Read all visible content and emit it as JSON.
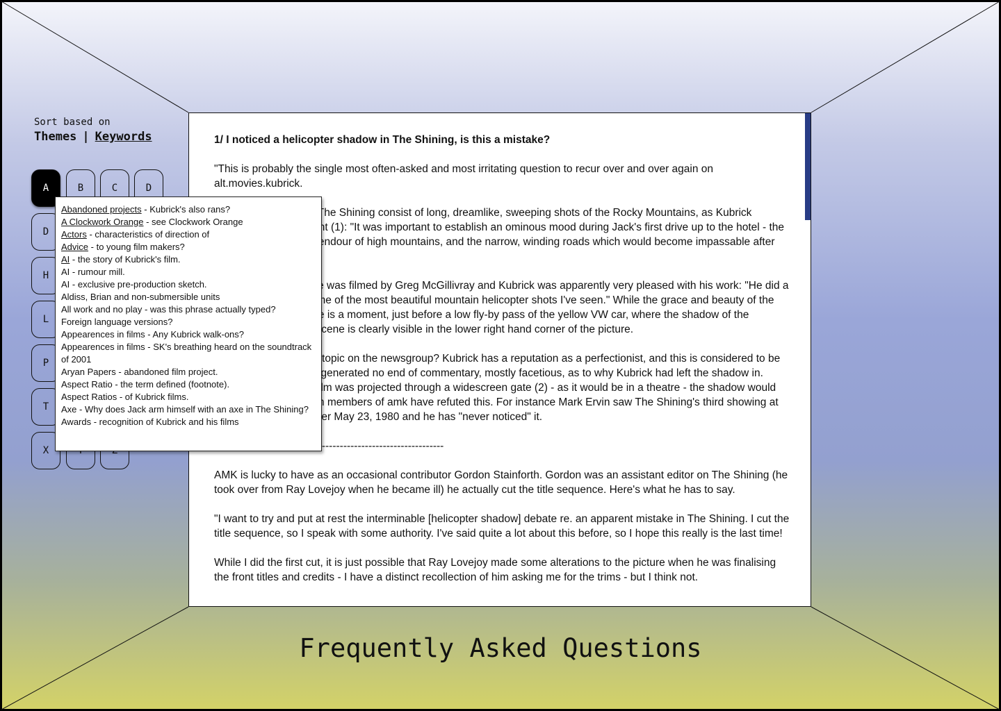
{
  "sort": {
    "label": "Sort based on",
    "themes": "Themes",
    "separator": "|",
    "keywords": "Keywords"
  },
  "letters": [
    "A",
    "B",
    "C",
    "D",
    "D",
    "H",
    "L",
    "P",
    "T",
    "X",
    "Y",
    "Z"
  ],
  "active_letter": "A",
  "popup_items": [
    {
      "link": "Abandoned projects",
      "text": " - Kubrick's also rans?"
    },
    {
      "link": "A Clockwork Orange",
      "text": " - see Clockwork Orange"
    },
    {
      "link": "Actors",
      "text": " - characteristics of direction of"
    },
    {
      "link": "Advice",
      "text": " - to young film makers?"
    },
    {
      "link": "AI",
      "text": " - the story of Kubrick's film."
    },
    {
      "link": "",
      "text": "AI - rumour mill."
    },
    {
      "link": "",
      "text": "AI - exclusive pre-production sketch."
    },
    {
      "link": "",
      "text": "Aldiss, Brian and non-submersible units"
    },
    {
      "link": "",
      "text": "All work and no play - was this phrase actually typed?"
    },
    {
      "link": "",
      "text": "Foreign language versions?"
    },
    {
      "link": "",
      "text": "Appearences in films - Any Kubrick walk-ons?"
    },
    {
      "link": "",
      "text": "Appearences in films - SK's breathing heard on the soundtrack of 2001"
    },
    {
      "link": "",
      "text": "Aryan Papers - abandoned film project."
    },
    {
      "link": "",
      "text": "Aspect Ratio - the term defined (footnote)."
    },
    {
      "link": "",
      "text": "Aspect Ratios - of Kubrick films."
    },
    {
      "link": "",
      "text": "Axe - Why does Jack arm himself with an axe in The Shining?"
    },
    {
      "link": "",
      "text": "Awards - recognition of Kubrick and his films"
    }
  ],
  "article": {
    "heading": "1/ I noticed a helicopter shadow in The Shining, is this a mistake?",
    "paragraphs": [
      "\"This is probably the single most often-asked and most irritating question to recur over and over again on alt.movies.kubrick.",
      "The opening shots of The Shining consist of long, dreamlike, sweeping shots of the Rocky Mountains, as Kubrick explained in a comment (1): \"It was important to establish an ominous mood during Jack's first drive up to the hotel - the isolation and eerie splendour of high mountains, and the narrow, winding roads which would become impassable after heavy snow.\"",
      "The opening sequence was filmed by Greg McGillivray and Kubrick was apparently very pleased with his work: \"He did a great job of filming some of the most beautiful mountain helicopter shots I've seen.\" While the grace and beauty of the shots is hypnotic, there is a moment, just before a low fly-by pass of the yellow VW car, where the shadow of the helicopter filming the scene is clearly visible in the lower right hand corner of the picture.",
      "Why is this such a hot topic on the newsgroup? Kubrick has a reputation as a perfectionist, and this is considered to be an apparent gaffe. It's generated no end of commentary, mostly facetious, as to why Kubrick had left the shadow in. Some say that, if the film was projected through a widescreen gate (2) - as it would be in a theatre - the shadow would not be visible, although members of amk have refuted this. For instance Mark Ervin saw The Shining's third showing at Mann's Chinese Theater May 23, 1980 and he has \"never noticed\" it.",
      "----------------------------------------------------------------",
      "AMK is lucky to have as an occasional contributor Gordon Stainforth. Gordon was an assistant editor on The Shining (he took over from Ray Lovejoy when he became ill) he actually cut the title sequence. Here's what he has to say.",
      "\"I want to try and put at rest the interminable [helicopter shadow] debate re. an apparent mistake in The Shining. I cut the title sequence, so I speak with some authority. I've said quite a lot about this before, so I hope this really is the last time!",
      "While I did the first cut, it is just possible that Ray Lovejoy made some alterations to the picture when he was finalising the front titles and credits - I have a distinct recollection of him asking me for the trims - but I think not."
    ]
  },
  "page_title": "Frequently Asked Questions",
  "colors": {
    "scrollbar": "#283c86",
    "active_letter_bg": "#000000",
    "gradient_top": "#f3f4fa",
    "gradient_mid": "#93a0cf",
    "gradient_bottom": "#d3d268"
  }
}
